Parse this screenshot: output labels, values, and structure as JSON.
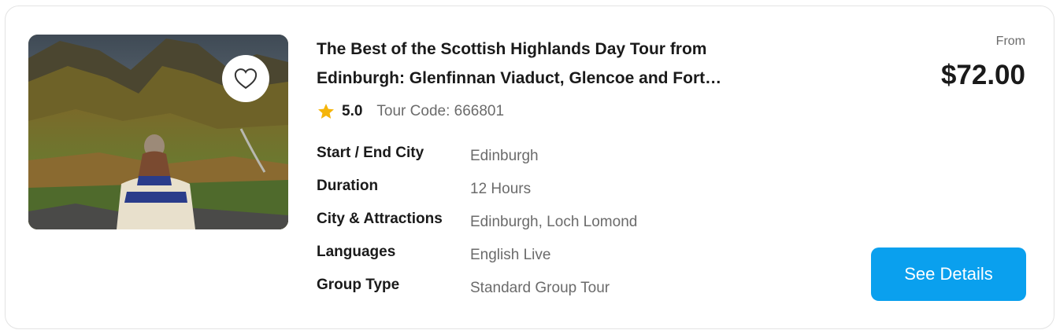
{
  "tour": {
    "title_line1": "The Best of the Scottish Highlands Day Tour from",
    "title_line2": "Edinburgh: Glenfinnan Viaduct, Glencoe and Fort…",
    "rating": "5.0",
    "tour_code": "Tour Code: 666801",
    "favorite_icon": "heart-outline-icon",
    "rating_icon": "star-icon",
    "star_color": "#f5b50a"
  },
  "specs": [
    {
      "label": "Start / End City",
      "value": "Edinburgh"
    },
    {
      "label": "Duration",
      "value": "12 Hours"
    },
    {
      "label": "City & Attractions",
      "value": "Edinburgh, Loch Lomond"
    },
    {
      "label": "Languages",
      "value": "English Live"
    },
    {
      "label": "Group Type",
      "value": "Standard Group Tour"
    }
  ],
  "pricing": {
    "from_label": "From",
    "price": "$72.00"
  },
  "actions": {
    "see_details_label": "See Details",
    "button_color": "#0aa0ee"
  }
}
